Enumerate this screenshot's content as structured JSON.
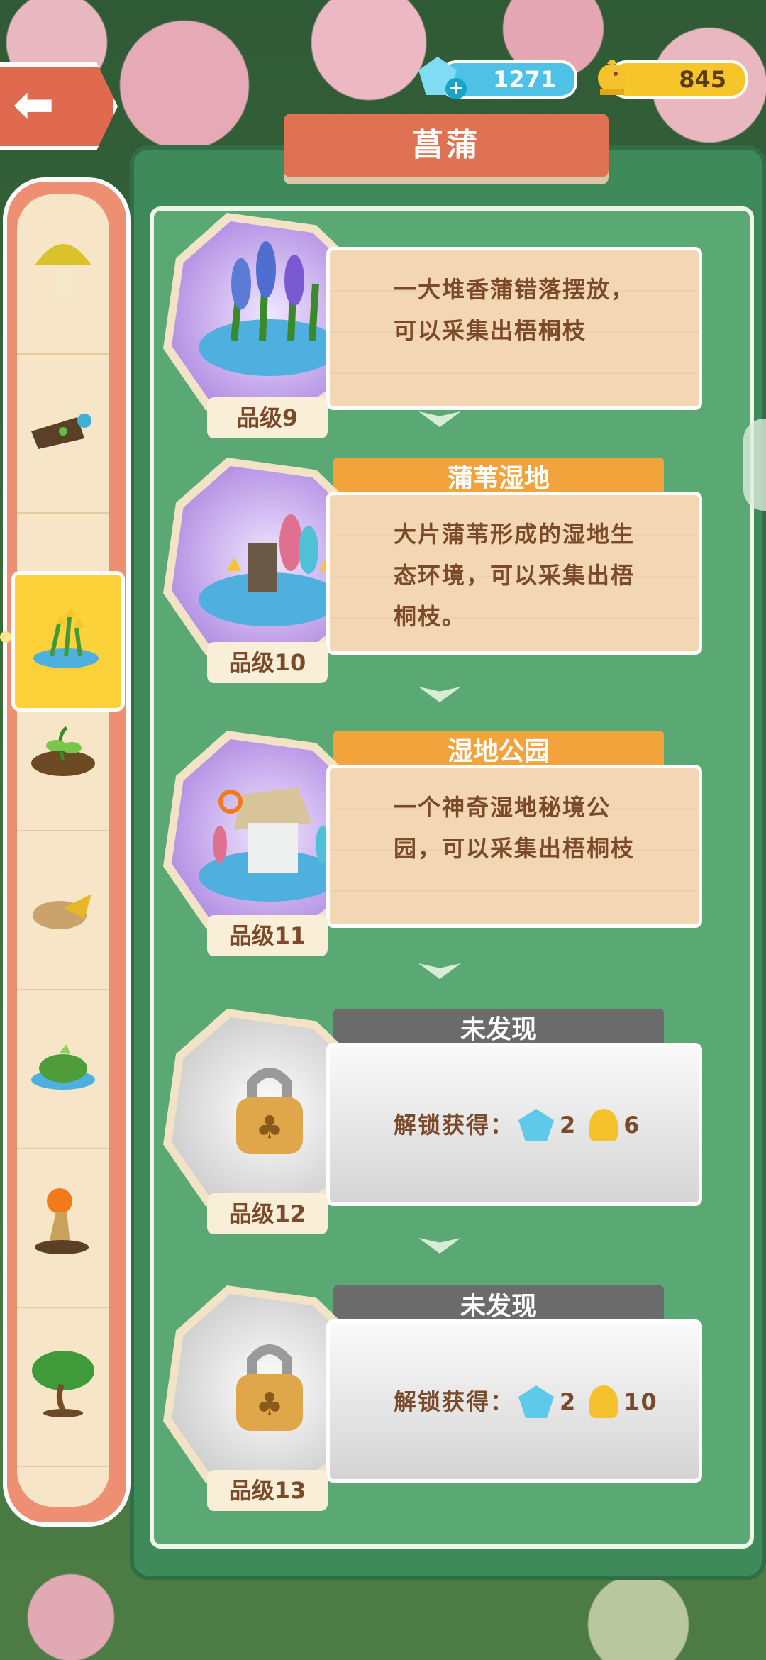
{
  "header": {
    "back_label": "⬅",
    "gems": "1271",
    "gold": "845",
    "title": "菖蒲"
  },
  "sidebar": {
    "items": [
      {
        "name": "mushroom"
      },
      {
        "name": "log"
      },
      {
        "name": "flower-pond",
        "active": true
      },
      {
        "name": "sprout"
      },
      {
        "name": "leaf-rock"
      },
      {
        "name": "moss-rock"
      },
      {
        "name": "glow-stump"
      },
      {
        "name": "bonsai-tree"
      }
    ]
  },
  "cards": [
    {
      "grade": "品级9",
      "name": "",
      "desc_lines": [
        "一大堆香蒲错落摆放，",
        "可以采集出梧桐枝"
      ],
      "locked": false
    },
    {
      "grade": "品级10",
      "name": "蒲苇湿地",
      "desc_lines": [
        "大片蒲苇形成的湿地生",
        "态环境，可以采集出梧",
        "桐枝。"
      ],
      "locked": false
    },
    {
      "grade": "品级11",
      "name": "湿地公园",
      "desc_lines": [
        "一个神奇湿地秘境公",
        "园，可以采集出梧桐枝"
      ],
      "locked": false
    },
    {
      "grade": "品级12",
      "name": "未发现",
      "unlock_label": "解锁获得：",
      "gems": "2",
      "gold": "6",
      "locked": true
    },
    {
      "grade": "品级13",
      "name": "未发现",
      "unlock_label": "解锁获得：",
      "gems": "2",
      "gold": "10",
      "locked": true
    }
  ],
  "colors": {
    "panel": "#3f8a5a",
    "accent": "#e07254",
    "namebar": "#f2a33b",
    "locked": "#6b6b6b"
  }
}
